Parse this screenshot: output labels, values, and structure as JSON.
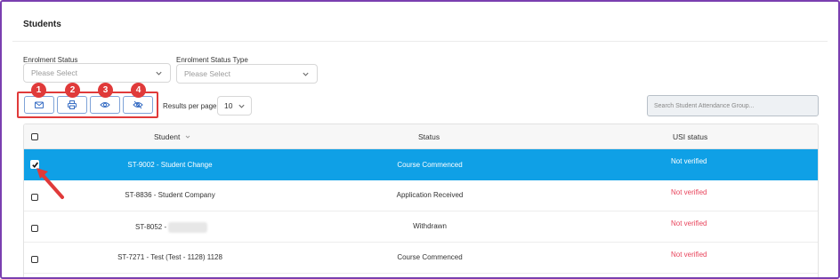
{
  "page": {
    "title": "Students"
  },
  "filters": {
    "enrolment_status": {
      "label": "Enrolment Status",
      "placeholder": "Please Select"
    },
    "enrolment_status_type": {
      "label": "Enrolment Status Type",
      "placeholder": "Please Select"
    }
  },
  "toolbar": {
    "buttons": [
      {
        "icon": "envelope-icon",
        "badge": "1"
      },
      {
        "icon": "printer-icon",
        "badge": "2"
      },
      {
        "icon": "eye-icon",
        "badge": "3"
      },
      {
        "icon": "eye-off-icon",
        "badge": "4"
      }
    ],
    "results_per_page_label": "Results per page",
    "results_per_page_value": "10",
    "search_placeholder": "Search Student Attendance Group..."
  },
  "table": {
    "columns": {
      "student": "Student",
      "status": "Status",
      "usi": "USI status"
    },
    "rows": [
      {
        "student": "ST-9002 - Student Change",
        "status": "Course Commenced",
        "usi": "Not verified",
        "selected": true
      },
      {
        "student": "ST-8836 - Student Company",
        "status": "Application Received",
        "usi": "Not verified",
        "selected": false
      },
      {
        "student": "ST-8052 -",
        "status": "Withdrawn",
        "usi": "Not verified",
        "selected": false
      },
      {
        "student": "ST-7271 - Test (Test - 1128) 1128",
        "status": "Course Commenced",
        "usi": "Not verified",
        "selected": false
      }
    ]
  },
  "colors": {
    "accent": "#0fa0e6",
    "annotation": "#e03a3a",
    "not_verified": "#e8445c",
    "frame": "#7a3fb0"
  }
}
